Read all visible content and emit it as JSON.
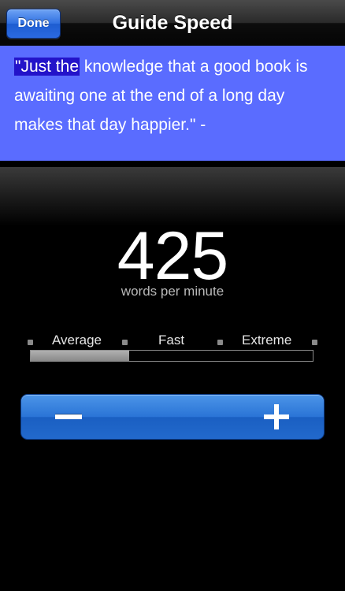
{
  "navbar": {
    "done_label": "Done",
    "title": "Guide Speed"
  },
  "quote": {
    "highlighted": "\"Just the",
    "rest": " knowledge that a good book is awaiting one at the end of a long day makes that day happier.\" -",
    "background": "#5a6cff",
    "highlight_color": "#2313c9"
  },
  "speed": {
    "value": "425",
    "unit": "words per minute",
    "fill_fraction": 0.35
  },
  "scale": {
    "labels": [
      "Average",
      "Fast",
      "Extreme"
    ]
  },
  "stepper": {
    "decrease_icon": "minus-icon",
    "increase_icon": "plus-icon",
    "accent": "#2a74d6"
  }
}
